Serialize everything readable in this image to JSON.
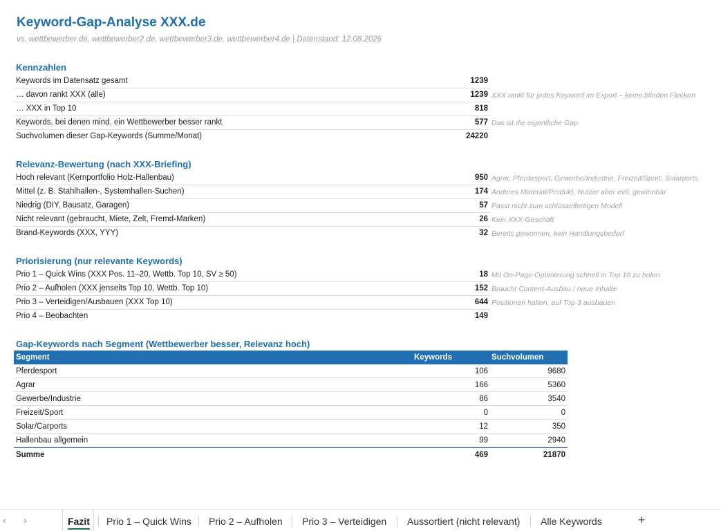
{
  "title": "Keyword-Gap-Analyse XXX.de",
  "subtitle": "vs. wettbewerber.de, wettbewerber2.de, wettbewerber3.de, wettbewerber4.de | Datenstand: 12.08.2026",
  "kennzahlen": {
    "heading": "Kennzahlen",
    "rows": [
      {
        "label": "Keywords im Datensatz gesamt",
        "value": "1239",
        "note": ""
      },
      {
        "label": "… davon rankt XXX (alle)",
        "value": "1239",
        "note": "XXX rankt für jedes Keyword im Export – keine blinden Flecken"
      },
      {
        "label": "… XXX in Top 10",
        "value": "818",
        "note": ""
      },
      {
        "label": "Keywords, bei denen mind. ein Wettbewerber besser rankt",
        "value": "577",
        "note": "Das ist die eigentliche Gap"
      },
      {
        "label": "Suchvolumen dieser Gap-Keywords (Summe/Monat)",
        "value": "24220",
        "note": ""
      }
    ]
  },
  "relevanz": {
    "heading": "Relevanz-Bewertung (nach XXX-Briefing)",
    "rows": [
      {
        "label": "Hoch relevant (Kernportfolio Holz-Hallenbau)",
        "value": "950",
        "note": "Agrar, Pferdesport, Gewerbe/Industrie, Freizeit/Sport, Solarports"
      },
      {
        "label": "Mittel (z. B. Stahlhallen-, Systemhallen-Suchen)",
        "value": "174",
        "note": "Anderes Material/Produkt, Nutzer aber evtl. gewinnbar"
      },
      {
        "label": "Niedrig (DIY, Bausatz, Garagen)",
        "value": "57",
        "note": "Passt nicht zum schlüsselfertigen Modell"
      },
      {
        "label": "Nicht relevant (gebraucht, Miete, Zelt, Fremd-Marken)",
        "value": "26",
        "note": "Kein XXX-Geschäft"
      },
      {
        "label": "Brand-Keywords (XXX, YYY)",
        "value": "32",
        "note": "Bereits gewonnen, kein Handlungsbedarf"
      }
    ]
  },
  "prio": {
    "heading": "Priorisierung (nur relevante Keywords)",
    "rows": [
      {
        "label": "Prio 1 – Quick Wins (XXX Pos. 11–20, Wettb. Top 10, SV ≥ 50)",
        "value": "18",
        "note": "Mit On-Page-Optimierung schnell in Top 10 zu holen"
      },
      {
        "label": "Prio 2 – Aufholen (XXX jenseits Top 10, Wettb. Top 10)",
        "value": "152",
        "note": "Braucht Content-Ausbau / neue Inhalte"
      },
      {
        "label": "Prio 3 – Verteidigen/Ausbauen (XXX Top 10)",
        "value": "644",
        "note": "Positionen halten, auf Top 3 ausbauen"
      },
      {
        "label": "Prio 4 – Beobachten",
        "value": "149",
        "note": ""
      }
    ]
  },
  "segment": {
    "heading": "Gap-Keywords nach Segment (Wettbewerber besser, Relevanz hoch)",
    "headers": [
      "Segment",
      "Keywords",
      "Suchvolumen"
    ],
    "rows": [
      [
        "Pferdesport",
        "106",
        "9680"
      ],
      [
        "Agrar",
        "166",
        "5360"
      ],
      [
        "Gewerbe/Industrie",
        "86",
        "3540"
      ],
      [
        "Freizeit/Sport",
        "0",
        "0"
      ],
      [
        "Solar/Carports",
        "12",
        "350"
      ],
      [
        "Hallenbau allgemein",
        "99",
        "2940"
      ]
    ],
    "sum": [
      "Summe",
      "469",
      "21870"
    ]
  },
  "tabs": {
    "items": [
      "Fazit",
      "Prio 1 – Quick Wins",
      "Prio 2 – Aufholen",
      "Prio 3 – Verteidigen",
      "Aussortiert (nicht relevant)",
      "Alle Keywords"
    ],
    "active": "Fazit",
    "prev_icon": "‹",
    "next_icon": "›",
    "add_icon": "+"
  },
  "colors": {
    "accent": "#1f6fb2",
    "tab_active": "#1e7145"
  }
}
